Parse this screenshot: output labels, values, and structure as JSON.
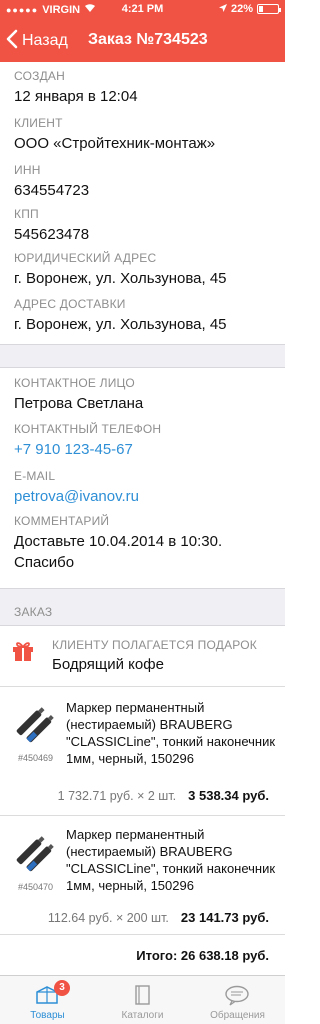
{
  "status_bar": {
    "carrier": "VIRGIN",
    "time": "4:21 PM",
    "battery": "22%",
    "battery_level": 0.22
  },
  "nav": {
    "back_label": "Назад",
    "title": "Заказ №734523"
  },
  "details": {
    "created_label": "СОЗДАН",
    "created_value": "12 января в 12:04",
    "client_label": "КЛИЕНТ",
    "client_value": "ООО «Стройтехник-монтаж»",
    "inn_label": "ИНН",
    "inn_value": "634554723",
    "kpp_label": "КПП",
    "kpp_value": "545623478",
    "legal_address_label": "ЮРИДИЧЕСКИЙ АДРЕС",
    "legal_address_value": "г. Воронеж, ул. Хользунова, 45",
    "delivery_address_label": "АДРЕС ДОСТАВКИ",
    "delivery_address_value": "г. Воронеж, ул. Хользунова, 45"
  },
  "contact": {
    "person_label": "КОНТАКТНОЕ ЛИЦО",
    "person_value": "Петрова Светлана",
    "phone_label": "КОНТАКТНЫЙ ТЕЛЕФОН",
    "phone_value": "+7 910 123-45-67",
    "email_label": "E-MAIL",
    "email_value": "petrova@ivanov.ru",
    "comment_label": "КОММЕНТАРИЙ",
    "comment_line1": "Доставьте 10.04.2014 в 10:30.",
    "comment_line2": "Спасибо"
  },
  "order": {
    "section_label": "ЗАКАЗ",
    "gift_label": "КЛИЕНТУ ПОЛАГАЕТСЯ ПОДАРОК",
    "gift_value": "Бодрящий кофе",
    "items": [
      {
        "article": "#450469",
        "name": "Маркер перманентный (нестираемый) BRAUBERG \"CLASSICLine\", тонкий наконечник 1мм, черный, 150296",
        "unit_price_qty": "1 732.71 руб. × 2 шт.",
        "line_total": "3 538.34 руб."
      },
      {
        "article": "#450470",
        "name": "Маркер перманентный (нестираемый) BRAUBERG \"CLASSICLine\", тонкий наконечник 1мм, черный, 150296",
        "unit_price_qty": "112.64 руб. × 200 шт.",
        "line_total": "23 141.73 руб."
      }
    ],
    "total": "Итого: 26 638.18 руб."
  },
  "tabs": [
    {
      "label": "Товары",
      "icon": "box-icon",
      "badge": "3"
    },
    {
      "label": "Каталоги",
      "icon": "catalog-icon"
    },
    {
      "label": "Обращения",
      "icon": "chat-bubble-icon"
    }
  ],
  "colors": {
    "accent": "#f05344",
    "link": "#2e8fd6",
    "label_gray": "#8e8e8e",
    "section_bg": "#efeff4"
  }
}
